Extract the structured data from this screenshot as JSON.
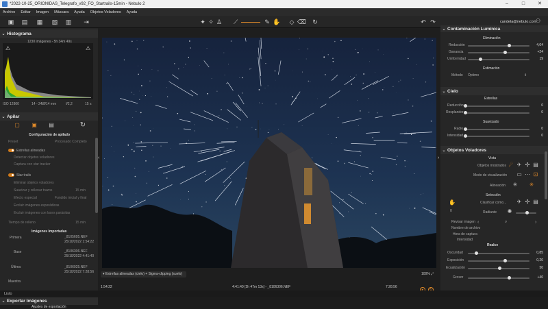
{
  "titlebar": {
    "title": "*2022-10-25_ORIONIDAS_Telegrafo_v92_FO_Startrails-15min - Nebulo 2"
  },
  "menu": [
    "Archivo",
    "Editar",
    "Imagen",
    "Máscara",
    "Ayuda",
    "Objetos Voladores",
    "Ayuda"
  ],
  "colors": {
    "accent": "#e08a2a",
    "bg": "#262626"
  },
  "left": {
    "histogram": {
      "title": "Histograma",
      "info": "1230 imágenes - 5h 34m 49s",
      "iso": "ISO 12800",
      "focal": "14 - 24Ø/14 mm",
      "aperture": "f/2,2",
      "exposure": "15 s"
    },
    "apilar": {
      "title": "Apilar",
      "config_title": "Configuración de apilado",
      "preset_label": "Preset",
      "preset_value": "Procesado Completo",
      "estrellas_alineadas": "Estrellas alineadas",
      "detectar": "Detectar objetos voladores",
      "captura": "Captura con star tracker",
      "star_trails": "Star trails",
      "eliminar": "Eliminar objetos voladores",
      "suavizar": "Suavizar y rellenar trazos",
      "suavizar_val": "15 min",
      "efecto": "Efecto especial",
      "efecto_val": "Fundido inicial y final",
      "excluir_esp": "Excluir imágenes esporádicas",
      "excluir_luces": "Excluir imágenes con luces parásitas",
      "tiempo_label": "Tiempo de relleno",
      "tiempo_val": "15 min"
    },
    "importadas": {
      "title": "Imágenes Importadas",
      "rows": [
        {
          "label": "Primera",
          "file": "_8105695.NEF",
          "date": "25/10/2022 1:54:22"
        },
        {
          "label": "Base",
          "file": "_8106306.NEF",
          "date": "25/10/2022 4:41:40"
        },
        {
          "label": "Última",
          "file": "_8106925.NEF",
          "date": "25/10/2022 7:28:56"
        }
      ],
      "maestra": "Maestra"
    },
    "exportar": {
      "title": "Exportar Imágenes",
      "sub": "Ajustes de exportación"
    }
  },
  "center": {
    "stack_label": "Estrellas alineadas (cielo) + Sigma-clipping (suelo)",
    "zoom": "100%",
    "time_start": "1:54:22",
    "time_mid": "4:41:40 [2h 47m 13s] - _8106306.NEF",
    "time_end": "7:28:56"
  },
  "right": {
    "user": "candela@nebulo.com",
    "contaminacion": {
      "title": "Contaminación Lumínica",
      "elim": "Eliminación",
      "reduccion": "Reducción",
      "reduccion_val": "4,04",
      "ganancia": "Ganancia",
      "ganancia_val": "+24",
      "uniformidad": "Uniformidad",
      "uniformidad_val": "19",
      "estimacion": "Estimación",
      "metodo": "Método",
      "metodo_val": "Óptimo"
    },
    "cielo": {
      "title": "Cielo",
      "estrellas": "Estrellas",
      "reduccion": "Reducción",
      "reduccion_val": "0",
      "resplandor": "Resplandor",
      "resplandor_val": "0",
      "suavizado": "Suavizado",
      "radio": "Radio",
      "radio_val": "0",
      "intensidad": "Intensidad",
      "intensidad_val": "0"
    },
    "objetos": {
      "title": "Objetos Voladores",
      "vista": "Vista",
      "mostrados": "Objetos mostrados",
      "modo": "Modo de visualización",
      "alineacion": "Alineación",
      "seleccion": "Selección",
      "clasificar": "Clasificar como...",
      "count": "0",
      "radiante": "Radiante",
      "revisar": "Revisar imagen",
      "nombre": "Nombre de archivo",
      "hora": "Hora de captura",
      "intensidad": "Intensidad"
    },
    "realce": {
      "title": "Realce",
      "oscuridad": "Oscuridad",
      "oscuridad_val": "0,85",
      "exposicion": "Exposición",
      "exposicion_val": "0,20",
      "ecualizacion": "Ecualización",
      "ecualizacion_val": "50",
      "grosor": "Grosor",
      "grosor_val": "+40"
    }
  },
  "status": {
    "text": "Listo"
  }
}
